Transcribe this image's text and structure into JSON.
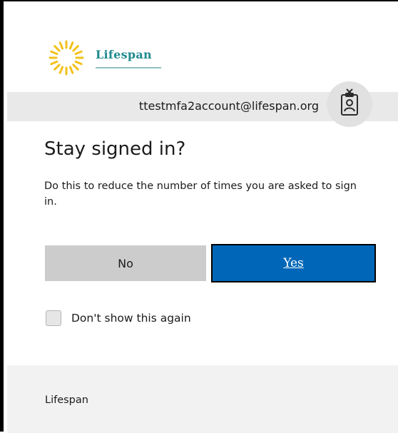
{
  "branding": {
    "logo_name": "Lifespan",
    "logo_icon": "sun-logo-icon"
  },
  "account": {
    "email": "ttestmfa2account@lifespan.org",
    "badge_icon": "id-badge-icon"
  },
  "dialog": {
    "title": "Stay signed in?",
    "description": "Do this to reduce the number of times you are asked to sign in.",
    "no_label": "No",
    "yes_label": "Yes",
    "checkbox_label": "Don't show this again",
    "checkbox_checked": false
  },
  "footer": {
    "text": "Lifespan"
  },
  "colors": {
    "brand_teal": "#1f8a8f",
    "brand_yellow": "#f2c21b",
    "primary_blue": "#0067b8",
    "secondary_gray": "#cccccc",
    "account_bar": "#e9e9e9",
    "footer_bg": "#f2f2f2"
  }
}
